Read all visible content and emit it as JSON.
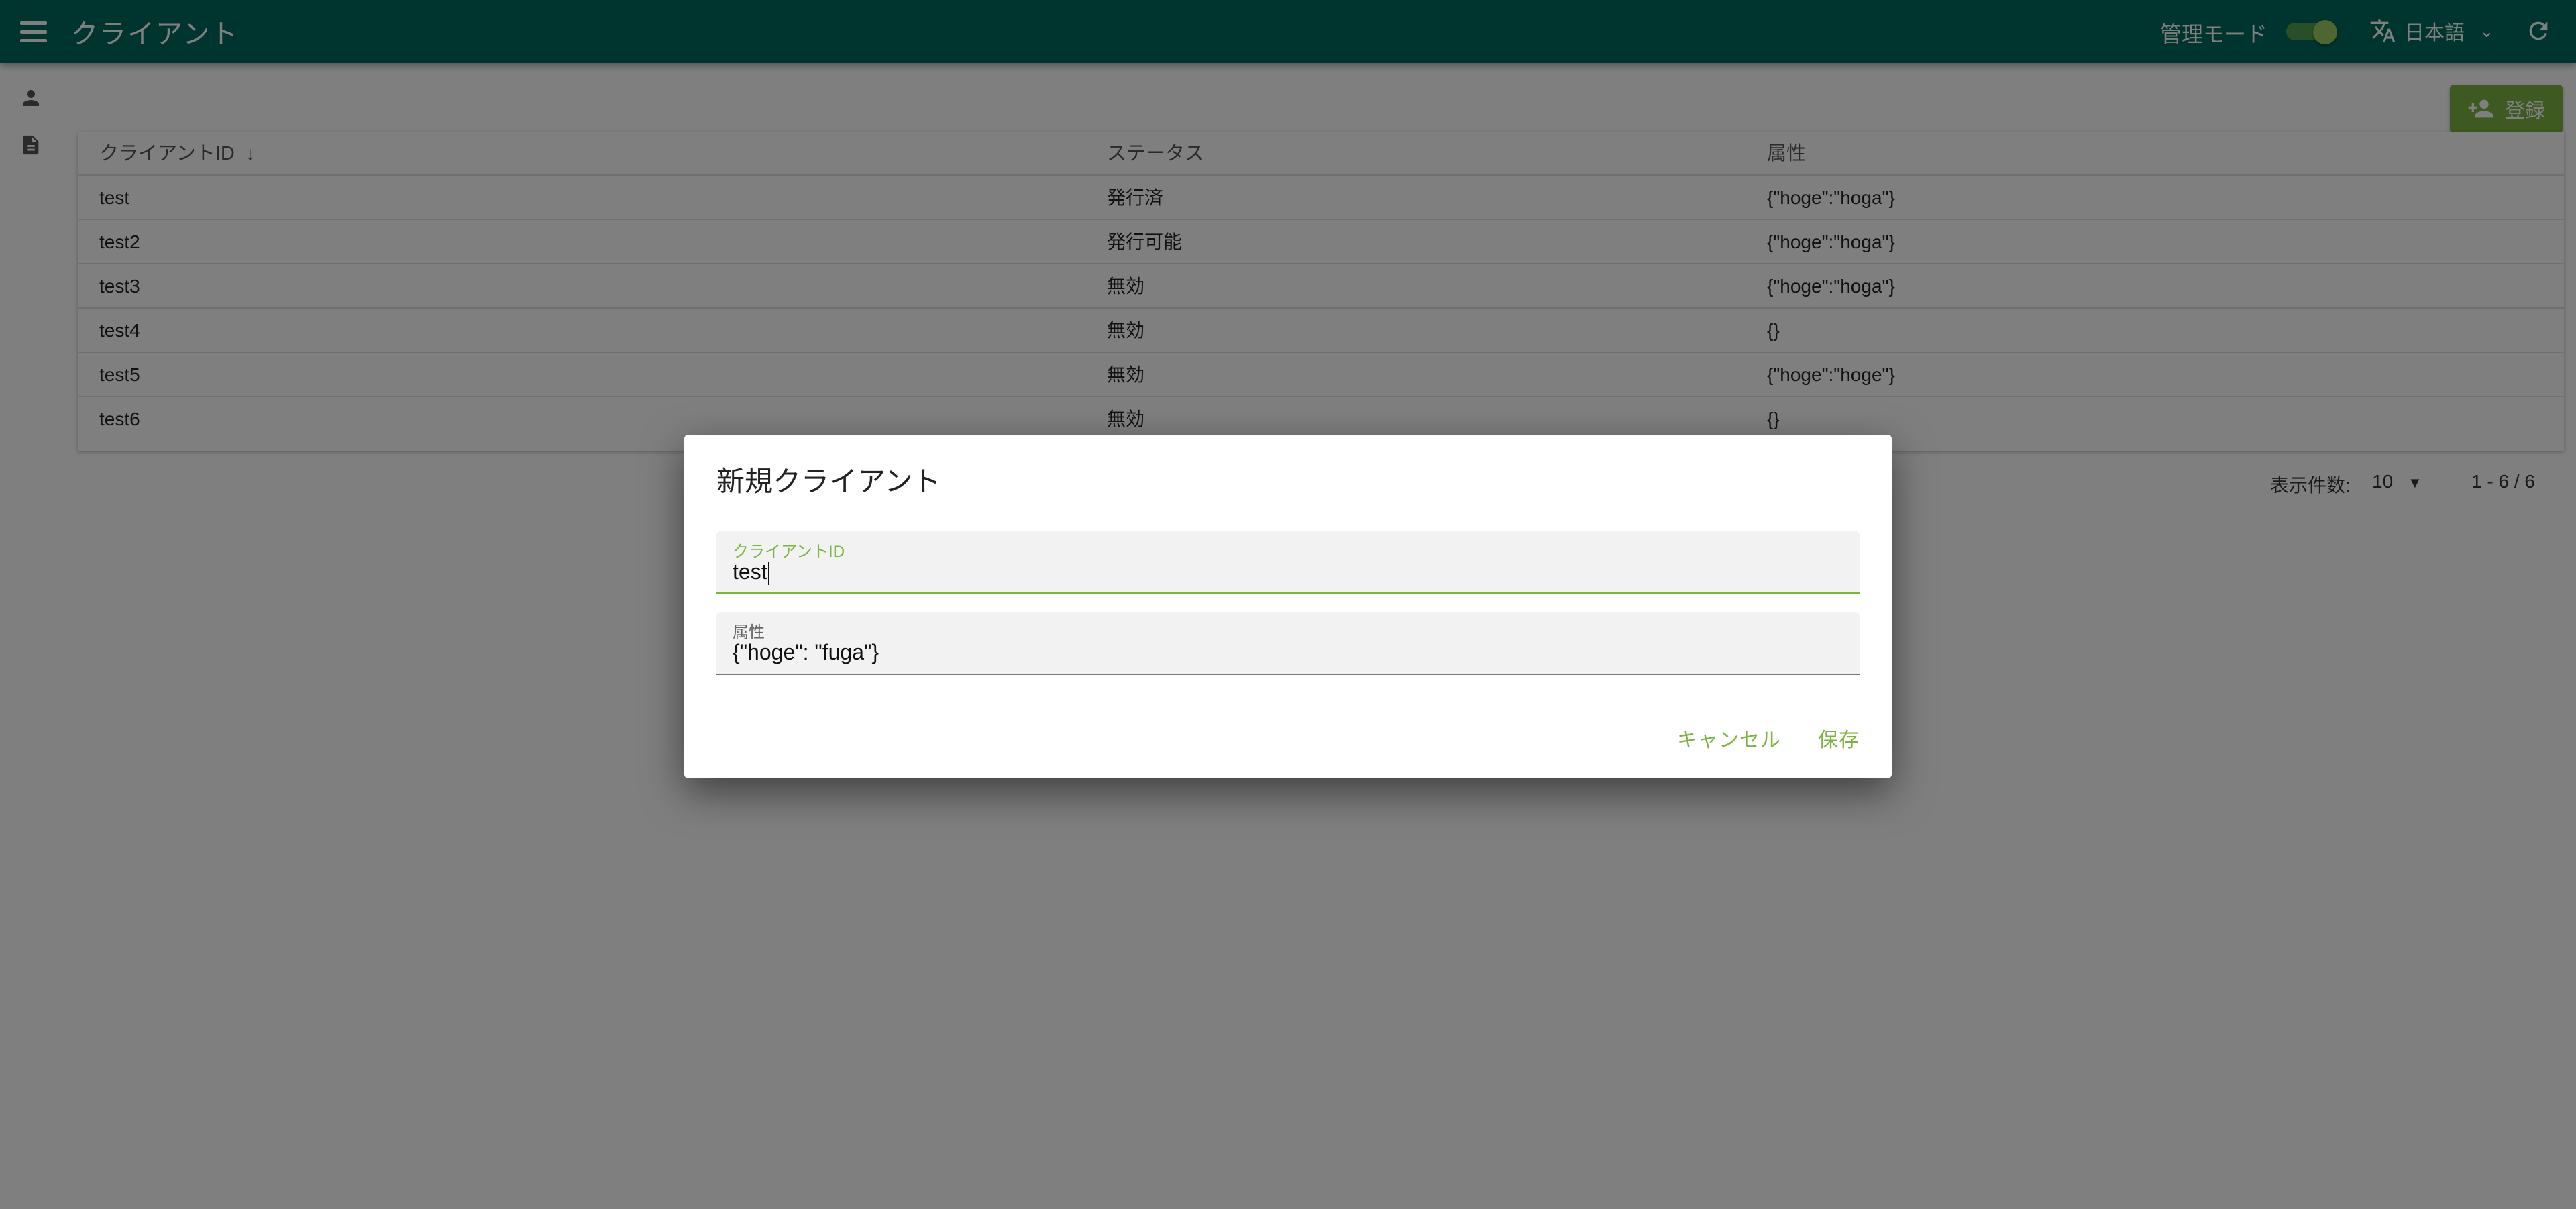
{
  "appbar": {
    "title": "クライアント",
    "admin_mode_label": "管理モード",
    "admin_mode_on": true,
    "language": "日本語"
  },
  "toolbar": {
    "register_label": "登録"
  },
  "table": {
    "headers": {
      "client_id": "クライアントID",
      "status": "ステータス",
      "attributes": "属性"
    },
    "rows": [
      {
        "client_id": "test",
        "status": "発行済",
        "attributes": "{\"hoge\":\"hoga\"}"
      },
      {
        "client_id": "test2",
        "status": "発行可能",
        "attributes": "{\"hoge\":\"hoga\"}"
      },
      {
        "client_id": "test3",
        "status": "無効",
        "attributes": "{\"hoge\":\"hoga\"}"
      },
      {
        "client_id": "test4",
        "status": "無効",
        "attributes": "{}"
      },
      {
        "client_id": "test5",
        "status": "無効",
        "attributes": "{\"hoge\":\"hoge\"}"
      },
      {
        "client_id": "test6",
        "status": "無効",
        "attributes": "{}"
      }
    ]
  },
  "pagination": {
    "per_page_label": "表示件数:",
    "per_page_value": "10",
    "range": "1 - 6 / 6"
  },
  "dialog": {
    "title": "新規クライアント",
    "client_id_label": "クライアントID",
    "client_id_value": "test",
    "attributes_label": "属性",
    "attributes_value": "{\"hoge\": \"fuga\"}",
    "cancel_label": "キャンセル",
    "save_label": "保存"
  },
  "colors": {
    "appbar": "#00695c",
    "accent": "#7cb342"
  },
  "icons": [
    "menu-icon",
    "translate-icon",
    "chevron-down-icon",
    "refresh-icon",
    "person-icon",
    "document-icon",
    "person-add-icon",
    "arrow-down-icon",
    "dropdown-arrow-icon"
  ]
}
